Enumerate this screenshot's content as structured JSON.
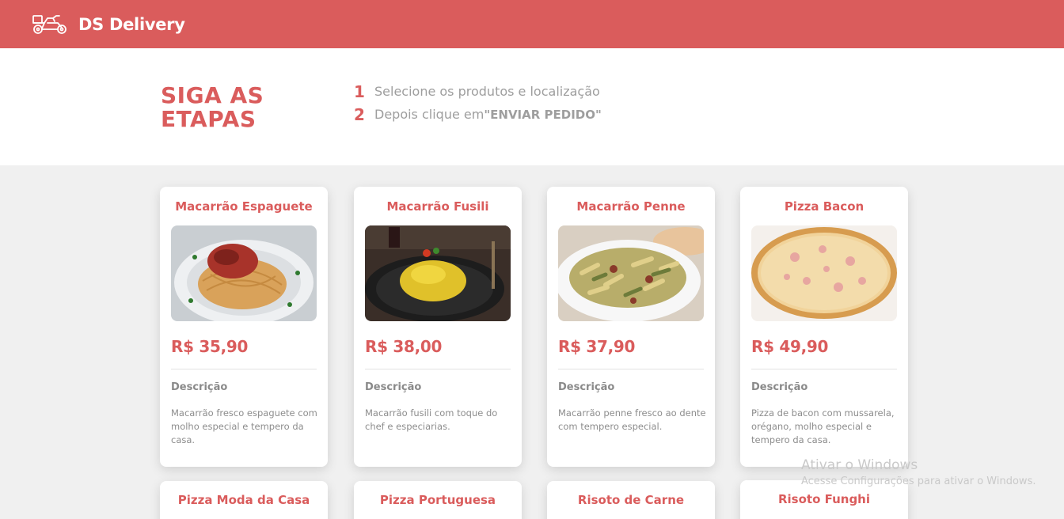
{
  "header": {
    "brand": "DS Delivery",
    "logo_icon": "motorcycle-delivery-icon"
  },
  "steps": {
    "title_line1": "SIGA AS",
    "title_line2": "ETAPAS",
    "items": [
      {
        "number": "1",
        "text": "Selecione os produtos e localização",
        "emphasis": ""
      },
      {
        "number": "2",
        "text": "Depois clique em",
        "emphasis": "\"ENVIAR PEDIDO\""
      }
    ]
  },
  "products": [
    {
      "name": "Macarrão Espaguete",
      "price": "R$ 35,90",
      "description_label": "Descrição",
      "description": "Macarrão fresco espaguete com molho especial e tempero da casa.",
      "image": "spaghetti-photo"
    },
    {
      "name": "Macarrão Fusili",
      "price": "R$ 38,00",
      "description_label": "Descrição",
      "description": "Macarrão fusili com toque do chef e especiarias.",
      "image": "fusilli-photo"
    },
    {
      "name": "Macarrão Penne",
      "price": "R$ 37,90",
      "description_label": "Descrição",
      "description": "Macarrão penne fresco ao dente com tempero especial.",
      "image": "penne-photo"
    },
    {
      "name": "Pizza Bacon",
      "price": "R$ 49,90",
      "description_label": "Descrição",
      "description": "Pizza de bacon com mussarela, orégano, molho especial e tempero da casa.",
      "image": "bacon-pizza-photo"
    },
    {
      "name": "Pizza Moda da Casa"
    },
    {
      "name": "Pizza Portuguesa"
    },
    {
      "name": "Risoto de Carne"
    },
    {
      "name": "Risoto Funghi"
    }
  ],
  "watermark": {
    "line1": "Ativar o Windows",
    "line2": "Acesse Configurações para ativar o Windows."
  },
  "colors": {
    "brand": "#da5c5c",
    "background": "#f0f0f0",
    "text_muted": "#9e9e9e"
  }
}
